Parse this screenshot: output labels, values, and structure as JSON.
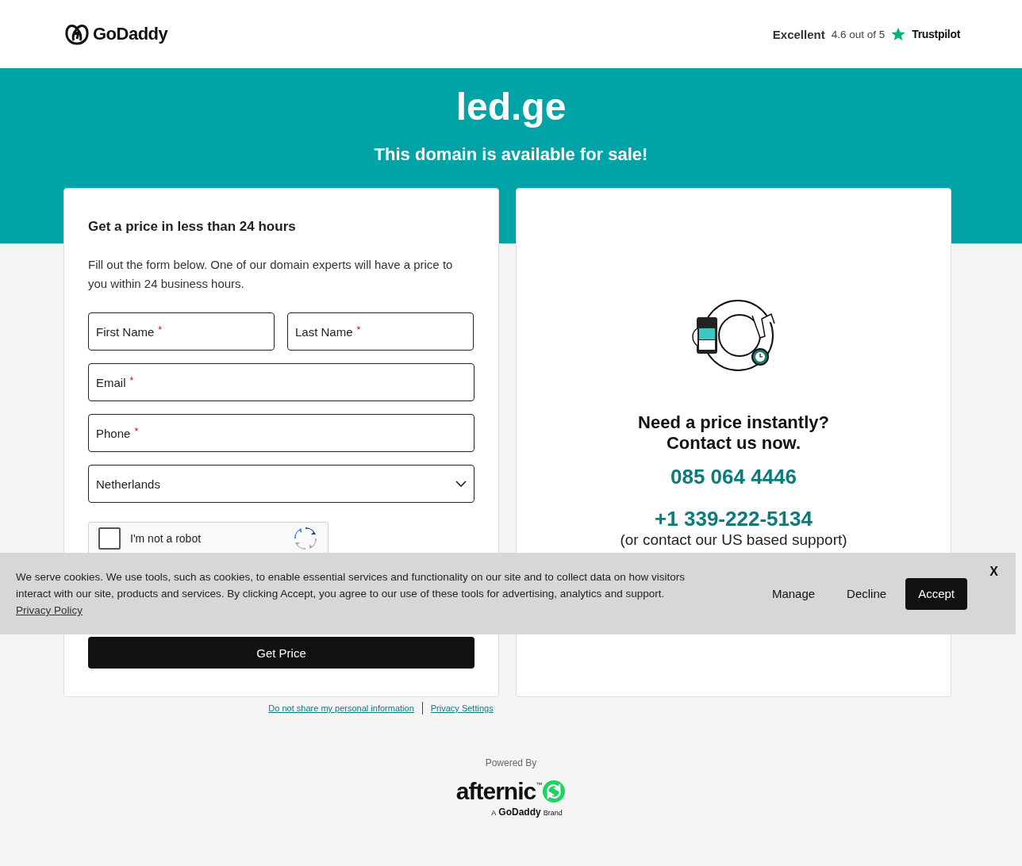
{
  "header": {
    "brand": "GoDaddy",
    "rating": {
      "label": "Excellent",
      "score": "4.6 out of 5",
      "provider": "Trustpilot"
    }
  },
  "hero": {
    "domain": "led.ge",
    "subtitle": "This domain is available for sale!"
  },
  "form": {
    "title": "Get a price in less than 24 hours",
    "intro": "Fill out the form below. One of our domain experts will have a price to you within 24 business hours.",
    "name_fields": [
      {
        "label": "First Name",
        "required_mark": "*"
      },
      {
        "label": "Last Name",
        "required_mark": "*"
      }
    ],
    "fields": [
      {
        "label": "Email",
        "required_mark": "*"
      },
      {
        "label": "Phone",
        "required_mark": "*"
      }
    ],
    "country": {
      "value": "Netherlands"
    },
    "captcha": {
      "label": "I'm not a robot",
      "checked": false
    },
    "submit": "Get Price"
  },
  "contact": {
    "heading_lines": [
      "Need a price instantly?",
      "Contact us now."
    ],
    "phone": "085 064 4446",
    "us_phone": "+1 339-222-5134",
    "us_note": "(or contact our US based support)"
  },
  "footer": {
    "links": [
      "Do not share my personal information",
      "Privacy Settings"
    ],
    "powered_by": "Powered By",
    "partner": "afternic",
    "partner_mark": "™",
    "partner_tagline_prefix": "A",
    "partner_tagline_brand": "GoDaddy",
    "partner_tagline_suffix": "Brand"
  },
  "cookie_banner": {
    "text": "We serve cookies. We use tools, such as cookies, to enable essential services and functionality on our site and to collect data on how visitors interact with our site, products and services. By clicking Accept, you agree to our use of these tools for advertising, analytics and support.",
    "policy_link": "Privacy Policy",
    "buttons": [
      {
        "label": "Manage",
        "primary": false
      },
      {
        "label": "Decline",
        "primary": false
      },
      {
        "label": "Accept",
        "primary": true
      }
    ],
    "close": "X"
  }
}
